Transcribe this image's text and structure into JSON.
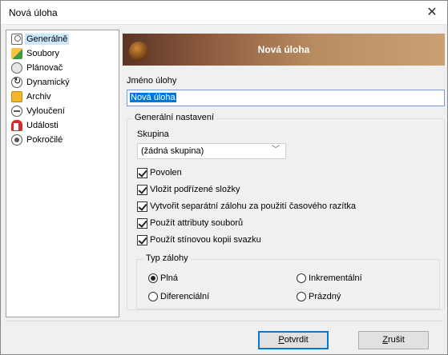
{
  "window": {
    "title": "Nová úloha",
    "close_glyph": "✕"
  },
  "sidebar": {
    "items": [
      {
        "label": "Generálně",
        "icon": "general-icon",
        "selected": true
      },
      {
        "label": "Soubory",
        "icon": "files-icon"
      },
      {
        "label": "Plánovač",
        "icon": "planner-icon"
      },
      {
        "label": "Dynamický",
        "icon": "dynamic-icon"
      },
      {
        "label": "Archiv",
        "icon": "archive-icon"
      },
      {
        "label": "Vyloučení",
        "icon": "exclusion-icon"
      },
      {
        "label": "Události",
        "icon": "events-icon"
      },
      {
        "label": "Pokročilé",
        "icon": "advanced-icon"
      }
    ]
  },
  "banner": {
    "title": "Nová úloha"
  },
  "task_name": {
    "label": "Jméno úlohy",
    "value": "Nová úloha"
  },
  "general": {
    "caption": "Generální nastavení",
    "group_label": "Skupina",
    "group_value": "(žádná skupina)",
    "checkboxes": [
      {
        "label": "Povolen",
        "checked": true
      },
      {
        "label": "Vložit podřízené složky",
        "checked": true
      },
      {
        "label": "Vytvořit separátní zálohu za použití časového razítka",
        "checked": true
      },
      {
        "label": "Použít attributy souborů",
        "checked": true
      },
      {
        "label": "Použít stínovou kopii svazku",
        "checked": true
      }
    ]
  },
  "backup_type": {
    "caption": "Typ zálohy",
    "options": [
      {
        "label": "Plná",
        "selected": true
      },
      {
        "label": "Inkrementální",
        "selected": false
      },
      {
        "label": "Diferenciální",
        "selected": false
      },
      {
        "label": "Prázdný",
        "selected": false
      }
    ]
  },
  "buttons": {
    "confirm": {
      "accel": "P",
      "rest": "otvrdit"
    },
    "cancel": {
      "accel": "Z",
      "rest": "rušit"
    }
  },
  "colors": {
    "accent": "#0078d7",
    "selection": "#cce8ff"
  }
}
